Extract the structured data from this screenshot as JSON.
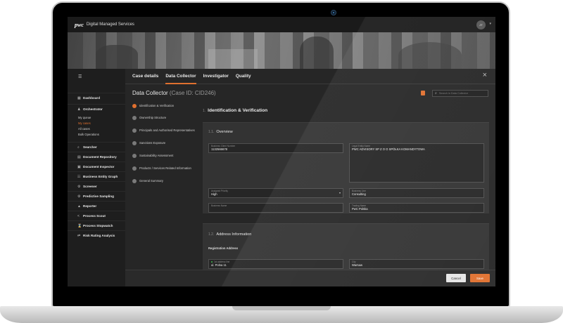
{
  "topbar": {
    "brand": "pwc",
    "title": "Digital Managed Services",
    "avatar_initials": "JT"
  },
  "sidebar": {
    "items": [
      {
        "label": "Dashboard",
        "icon": "grid-icon"
      },
      {
        "label": "Orchestrator",
        "icon": "user-icon"
      },
      {
        "label": "Searcher",
        "icon": "search-icon"
      },
      {
        "label": "Document Repository",
        "icon": "document-icon"
      },
      {
        "label": "Document Inspector",
        "icon": "inspector-icon"
      },
      {
        "label": "Business Entity Graph",
        "icon": "graph-icon"
      },
      {
        "label": "Screener",
        "icon": "gear-icon"
      },
      {
        "label": "Predictive Sampling",
        "icon": "gear-icon"
      },
      {
        "label": "Reporter",
        "icon": "chart-icon"
      },
      {
        "label": "Process Scout",
        "icon": "share-icon"
      },
      {
        "label": "Process Stopwatch",
        "icon": "hourglass-icon"
      },
      {
        "label": "Risk Rating Analysis",
        "icon": "transfer-icon"
      }
    ],
    "orchestrator_sub": [
      "My queue",
      "My cases",
      "All cases",
      "Bulk Operations"
    ]
  },
  "tabs": [
    "Case details",
    "Data Collector",
    "Investigator",
    "Quality"
  ],
  "page": {
    "title": "Data Collector",
    "case_id": "(Case ID: CID246)"
  },
  "search": {
    "placeholder": "Search in Data Collector"
  },
  "steps": [
    "Identification & Verification",
    "Ownership Structure",
    "Principals and Authorised Representatives",
    "Sanctions Exposure",
    "Sustainability Assessment",
    "Products / Services Related Information",
    "General Summary"
  ],
  "section": {
    "num": "1.",
    "title": "Identification & Verification"
  },
  "overview": {
    "num": "1.1.",
    "title": "Overview",
    "business_client_number": {
      "label": "Business Client Number",
      "value": "1132566678"
    },
    "legal_entity_name": {
      "label": "Legal Entity Name",
      "value": "PWC ADVISORY SP Z O O SPÓŁKA KOMANDYTOWA"
    },
    "assigned_priority": {
      "label": "Assigned Priority",
      "value": "High"
    },
    "business_line": {
      "label": "Business Line",
      "value": "Consulting"
    },
    "business_name": {
      "label": "Business Name",
      "value": ""
    },
    "trading_name": {
      "label": "Trading Name",
      "value": "PwC Polska"
    }
  },
  "address": {
    "num": "1.2.",
    "title": "Address Information",
    "registration_label": "Registration Address",
    "street": {
      "label": "1st address line",
      "value": "ul. Polna 11"
    },
    "city": {
      "label": "City",
      "value": "Warsaw"
    }
  },
  "footer": {
    "cancel": "Cancel",
    "save": "Save"
  },
  "colors": {
    "accent": "#e0702f",
    "background": "#2d2d2d"
  }
}
